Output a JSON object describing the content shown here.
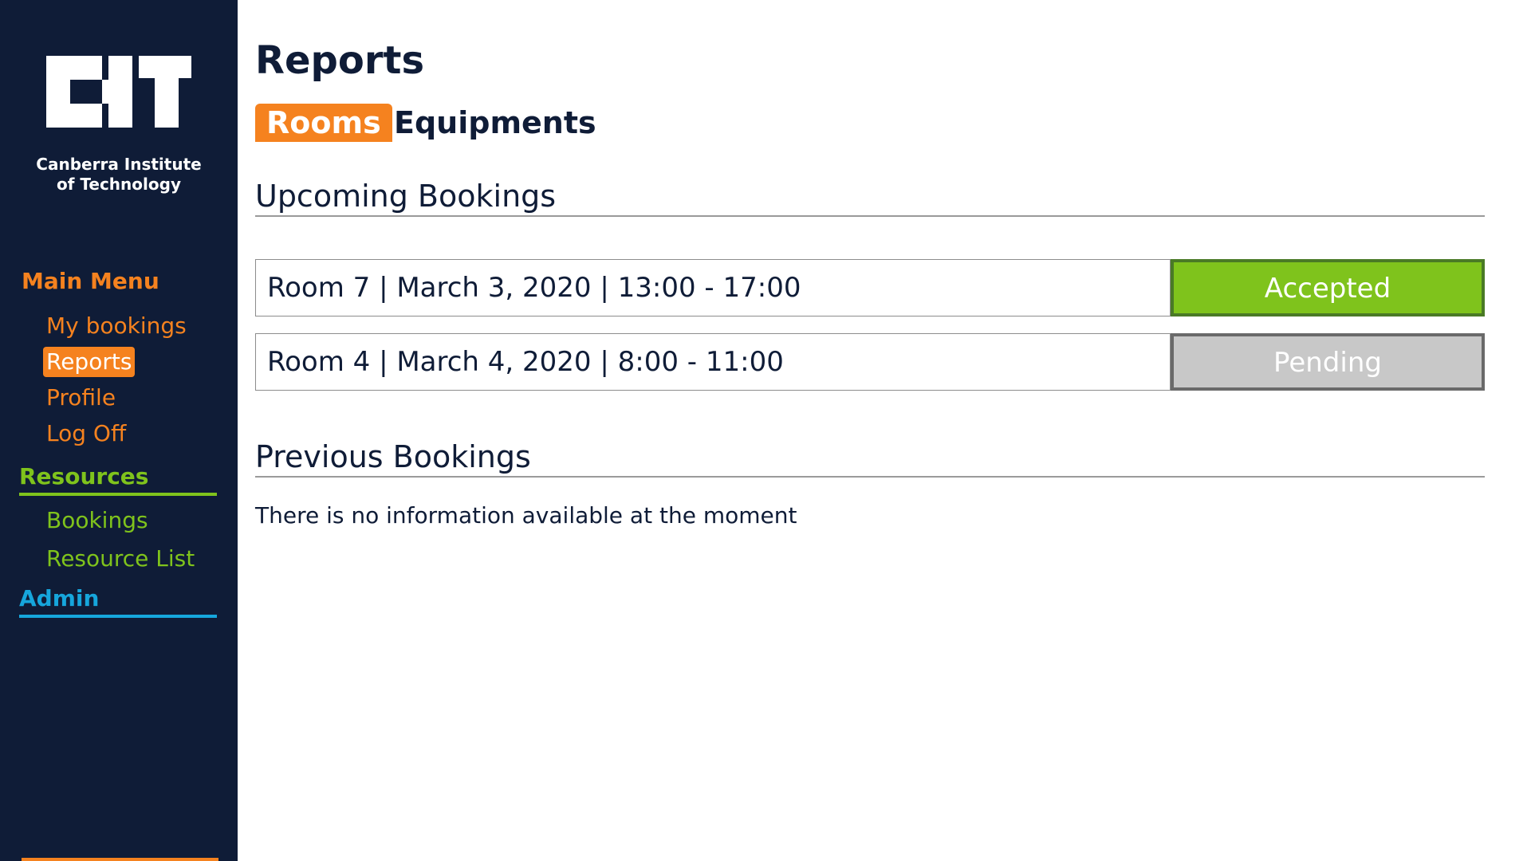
{
  "sidebar": {
    "logo_text_line1": "Canberra Institute",
    "logo_text_line2": "of Technology",
    "main_menu": {
      "heading": "Main Menu",
      "items": [
        "My bookings",
        "Reports",
        "Profile",
        "Log Off"
      ],
      "active": "Reports"
    },
    "resources": {
      "heading": "Resources",
      "items": [
        "Bookings",
        "Resource List"
      ]
    },
    "admin": {
      "heading": "Admin"
    }
  },
  "main": {
    "title": "Reports",
    "tabs": [
      "Rooms",
      "Equipments"
    ],
    "active_tab": "Rooms",
    "upcoming": {
      "title": "Upcoming Bookings",
      "rows": [
        {
          "text": "Room 7 | March 3, 2020 | 13:00 - 17:00",
          "status": "Accepted"
        },
        {
          "text": "Room 4 | March 4, 2020 | 8:00 - 11:00",
          "status": "Pending"
        }
      ]
    },
    "previous": {
      "title": "Previous Bookings",
      "empty_message": "There is no information available at the moment"
    }
  },
  "colors": {
    "sidebar_bg": "#0f1c37",
    "orange": "#f5821f",
    "green": "#7fc31c",
    "blue": "#16a6dc",
    "pending_gray": "#c8c8c8"
  }
}
